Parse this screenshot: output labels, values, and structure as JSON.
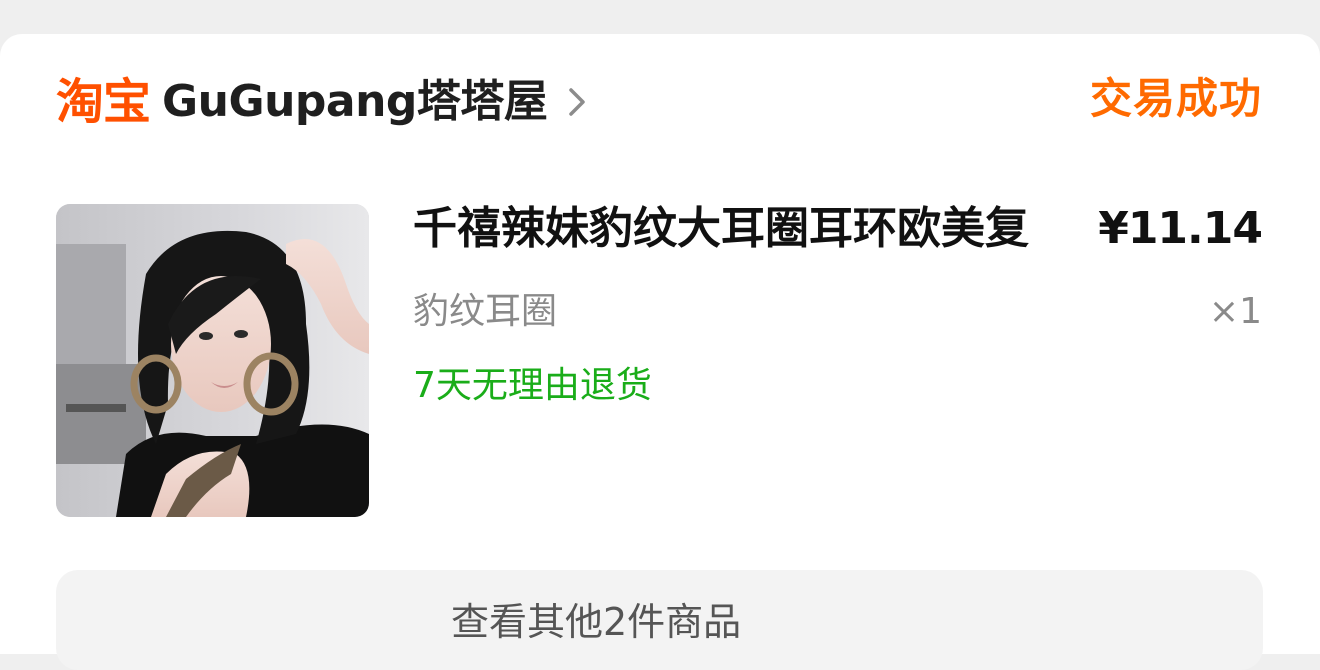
{
  "shop": {
    "brand": "淘宝",
    "name": "GuGupang塔塔屋",
    "chevron_icon": "chevron-right-icon"
  },
  "order": {
    "status": "交易成功"
  },
  "item": {
    "title": "千禧辣妹豹纹大耳圈耳环欧美复",
    "price": "¥11.14",
    "spec": "豹纹耳圈",
    "quantity": "×1",
    "return_policy": "7天无理由退货",
    "thumbnail": "product-photo"
  },
  "more": {
    "label": "查看其他2件商品"
  },
  "colors": {
    "brand": "#ff5000",
    "status": "#ff6a00",
    "return_policy": "#1aad19",
    "muted": "#8a8a8a"
  }
}
